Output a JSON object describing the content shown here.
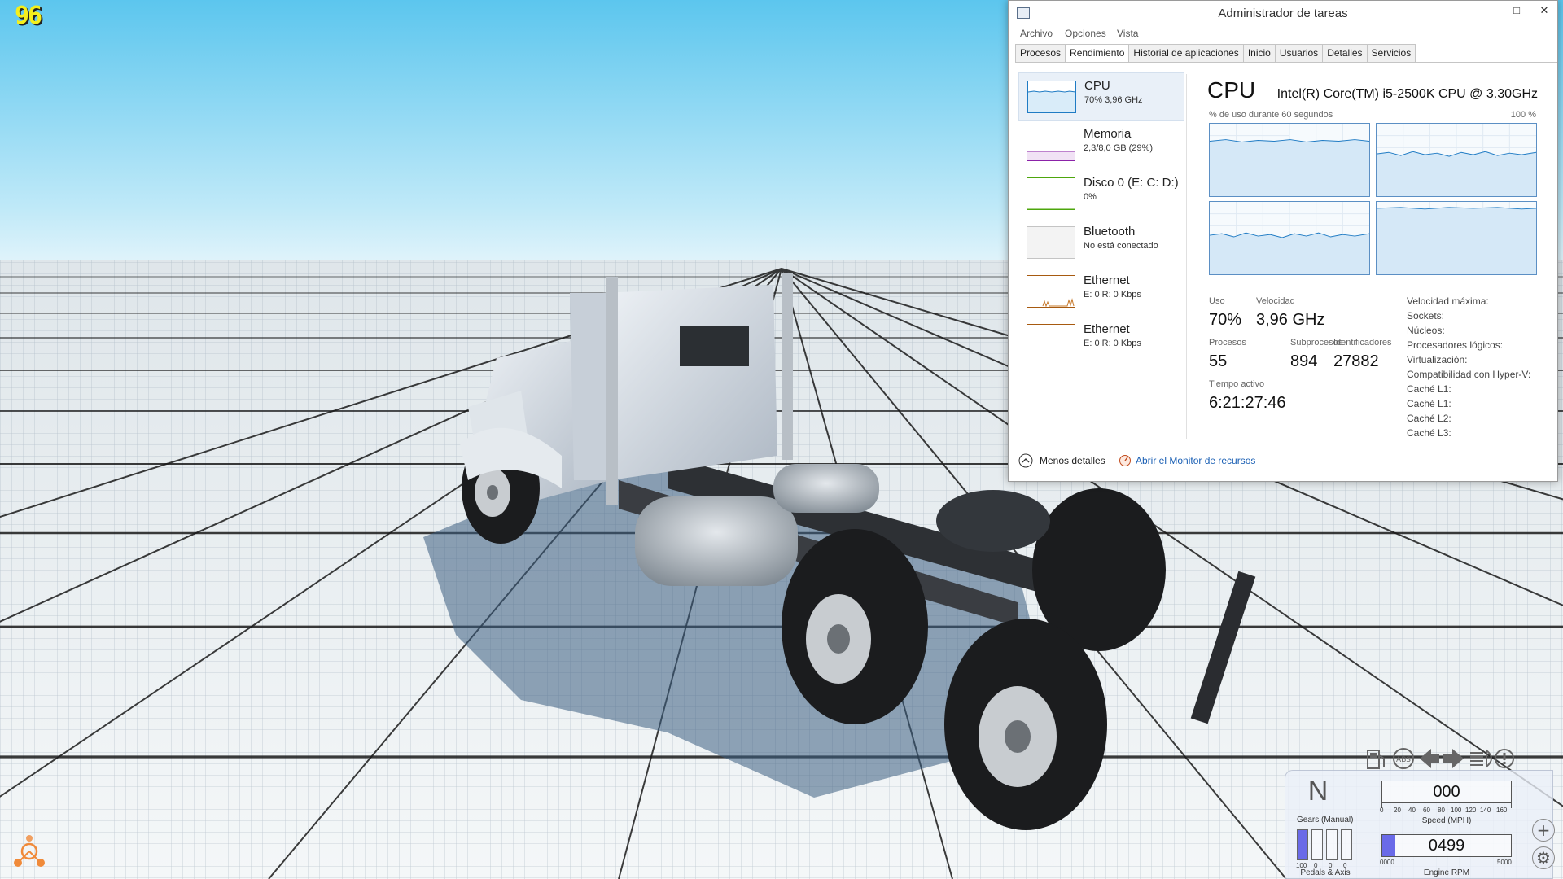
{
  "game": {
    "fps": "96"
  },
  "taskmanager": {
    "title": "Administrador de tareas",
    "window_controls": {
      "minimize": "–",
      "maximize": "□",
      "close": "✕"
    },
    "menu": [
      "Archivo",
      "Opciones",
      "Vista"
    ],
    "tabs": [
      "Procesos",
      "Rendimiento",
      "Historial de aplicaciones",
      "Inicio",
      "Usuarios",
      "Detalles",
      "Servicios"
    ],
    "active_tab": "Rendimiento",
    "perf_items": [
      {
        "name": "CPU",
        "value": "70% 3,96 GHz",
        "color": "#1f7bc4"
      },
      {
        "name": "Memoria",
        "value": "2,3/8,0 GB (29%)",
        "color": "#8b22a8"
      },
      {
        "name": "Disco 0 (E: C: D:)",
        "value": "0%",
        "color": "#4da60c"
      },
      {
        "name": "Bluetooth",
        "value": "No está conectado",
        "color": "#b0b0b0"
      },
      {
        "name": "Ethernet",
        "value": "E: 0 R: 0 Kbps",
        "color": "#a75a10"
      },
      {
        "name": "Ethernet",
        "value": "E: 0 R: 0 Kbps",
        "color": "#a75a10"
      }
    ],
    "cpu": {
      "heading": "CPU",
      "model": "Intel(R) Core(TM) i5-2500K CPU @ 3.30GHz",
      "graph_caption": "% de uso durante 60 segundos",
      "graph_max": "100 %",
      "uso_label": "Uso",
      "uso": "70%",
      "velocidad_label": "Velocidad",
      "velocidad": "3,96 GHz",
      "procesos_label": "Procesos",
      "procesos": "55",
      "subprocesos_label": "Subprocesos",
      "subprocesos": "894",
      "identificadores_label": "Identificadores",
      "identificadores": "27882",
      "tiempo_label": "Tiempo activo",
      "tiempo": "6:21:27:46",
      "specs": [
        "Velocidad máxima:",
        "Sockets:",
        "Núcleos:",
        "Procesadores lógicos:",
        "Virtualización:",
        "Compatibilidad con Hyper-V:",
        "Caché L1:",
        "Caché L1:",
        "Caché L2:",
        "Caché L3:"
      ]
    },
    "fewer_details": "Menos detalles",
    "resource_monitor": "Abrir el Monitor de recursos"
  },
  "hud": {
    "gear": "N",
    "gears_label": "Gears (Manual)",
    "speed": "000",
    "speed_label": "Speed (MPH)",
    "speed_ticks": [
      "0",
      "20",
      "40",
      "60",
      "80",
      "100",
      "120",
      "140",
      "160"
    ],
    "rpm": "0499",
    "rpm_label": "Engine RPM",
    "rpm_min": "0000",
    "rpm_max": "5000",
    "pedals_label": "Pedals & Axis",
    "pedal_ticks": [
      "100",
      "0",
      "0",
      "0"
    ],
    "abs_label": "ABS",
    "accent_color": "#6a6ae8"
  }
}
